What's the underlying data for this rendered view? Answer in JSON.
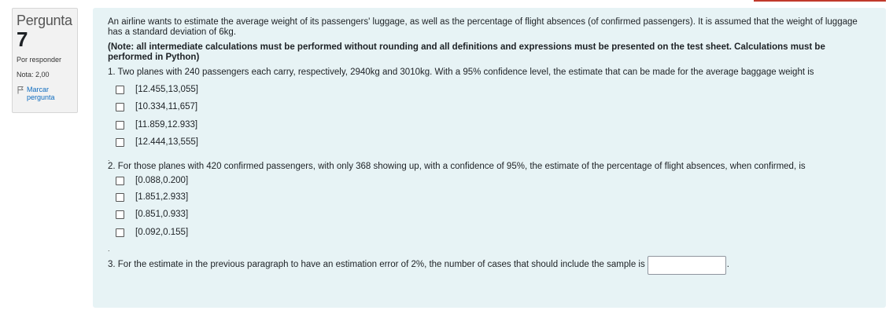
{
  "sidebar": {
    "question_word": "Pergunta",
    "question_number": "7",
    "state": "Por responder",
    "grade": "Nota: 2,00",
    "flag_label": "Marcar pergunta"
  },
  "question": {
    "intro": "An airline wants to estimate the average weight of its passengers' luggage, as well as the percentage of flight absences (of confirmed passengers). It is assumed that the weight of luggage has a standard deviation of 6kg.",
    "note": "(Note: all intermediate calculations must be performed without rounding and all definitions and expressions must be presented on the test sheet. Calculations must be performed in Python)",
    "part1": {
      "text": "1. Two planes with 240 passengers each carry, respectively, 2940kg and 3010kg. With a 95% confidence level, the estimate that can be made for the average baggage weight is",
      "options": [
        "[12.455,13,055]",
        "[10.334,11,657]",
        "[11.859,12.933]",
        "[12.444,13,555]"
      ]
    },
    "separator1": ".",
    "part2": {
      "text": "2. For those planes with 420 confirmed passengers, with only 368 showing up, with a confidence of 95%, the estimate of the percentage of flight absences, when confirmed, is",
      "options": [
        "[0.088,0.200]",
        "[1.851,2.933]",
        "[0.851,0.933]",
        "[0.092,0.155]"
      ]
    },
    "separator2": ".",
    "part3": {
      "text": "3. For the estimate in the previous paragraph to have an estimation error of 2%, the number of cases that should include the sample is",
      "input_value": "",
      "trailing": "."
    }
  },
  "colors": {
    "content_bg": "#e7f3f5",
    "sidebar_bg": "#f2f2f2",
    "link": "#0f6cbf",
    "accent": "#c0392b"
  }
}
